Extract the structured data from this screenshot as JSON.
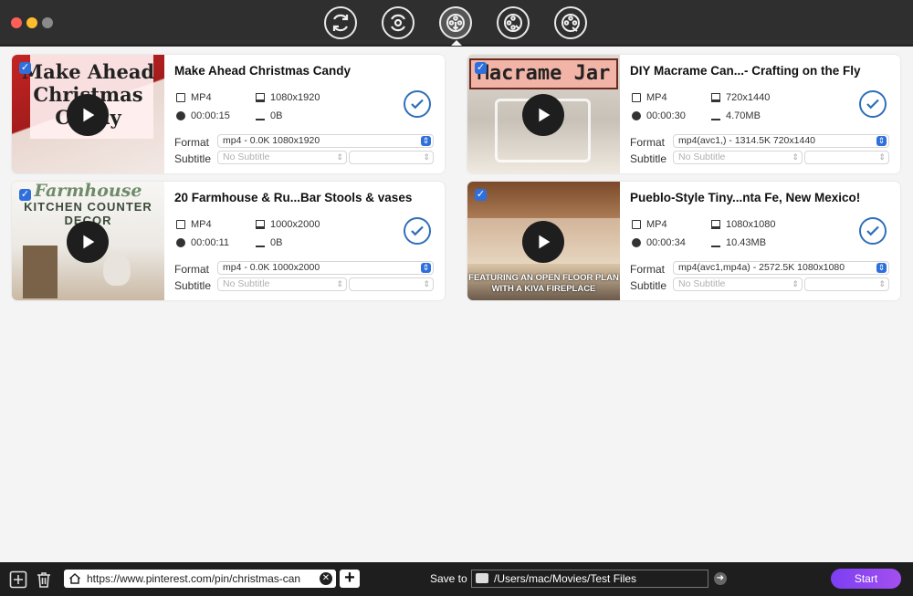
{
  "window": {
    "toolbar": [
      {
        "name": "convert-tool",
        "icon": "refresh-icon"
      },
      {
        "name": "settings-convert-tool",
        "icon": "gear-refresh-icon"
      },
      {
        "name": "download-tool",
        "icon": "film-download-icon",
        "active": true
      },
      {
        "name": "edit-tool",
        "icon": "film-edit-icon"
      },
      {
        "name": "film-tool",
        "icon": "film-settings-icon"
      }
    ]
  },
  "videos": [
    {
      "title": "Make Ahead Christmas Candy",
      "thumb_text": "Make Ahead Christmas Candy",
      "container": "MP4",
      "resolution": "1080x1920",
      "duration": "00:00:15",
      "size": "0B",
      "format_label": "Format",
      "format_value": "mp4 - 0.0K 1080x1920",
      "subtitle_label": "Subtitle",
      "subtitle_value": "No Subtitle"
    },
    {
      "title": "DIY Macrame Can...- Crafting on the Fly",
      "thumb_text": "Macrame Jar",
      "container": "MP4",
      "resolution": "720x1440",
      "duration": "00:00:30",
      "size": "4.70MB",
      "format_label": "Format",
      "format_value": "mp4(avc1,) - 1314.5K 720x1440",
      "subtitle_label": "Subtitle",
      "subtitle_value": "No Subtitle"
    },
    {
      "title": "20 Farmhouse & Ru...Bar Stools & vases",
      "thumb_text_script": "Farmhouse",
      "thumb_text": "KITCHEN COUNTER DECOR",
      "container": "MP4",
      "resolution": "1000x2000",
      "duration": "00:00:11",
      "size": "0B",
      "format_label": "Format",
      "format_value": "mp4 - 0.0K 1000x2000",
      "subtitle_label": "Subtitle",
      "subtitle_value": "No Subtitle"
    },
    {
      "title": "Pueblo-Style Tiny...nta Fe, New Mexico!",
      "thumb_text": "FEATURING AN OPEN FLOOR PLAN WITH A KIVA FIREPLACE",
      "container": "MP4",
      "resolution": "1080x1080",
      "duration": "00:00:34",
      "size": "10.43MB",
      "format_label": "Format",
      "format_value": "mp4(avc1,mp4a) - 2572.5K 1080x1080",
      "subtitle_label": "Subtitle",
      "subtitle_value": "No Subtitle"
    }
  ],
  "bottom": {
    "url": "https://www.pinterest.com/pin/christmas-can",
    "save_to_label": "Save to",
    "save_path": "/Users/mac/Movies/Test Files",
    "start_label": "Start"
  },
  "colors": {
    "accent": "#2f6fdc",
    "start_gradient_from": "#7b3ff2",
    "start_gradient_to": "#a44ff0",
    "toolbar_bg": "#2f2f2f",
    "content_bg": "#f4f4f4"
  }
}
